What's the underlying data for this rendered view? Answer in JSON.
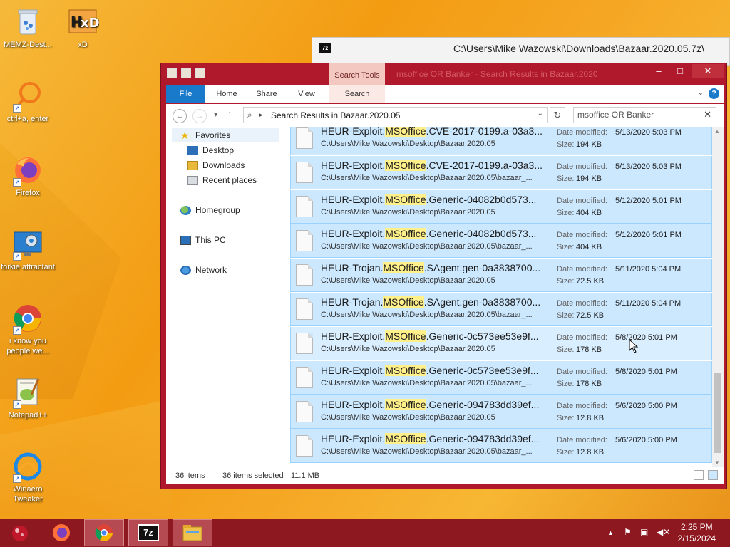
{
  "desktop": {
    "icons": [
      {
        "label": "MEMZ-Dest..."
      },
      {
        "label": "xD"
      },
      {
        "label": "ctrl+a, enter"
      },
      {
        "label": "Firefox"
      },
      {
        "label": "forkie attractant"
      },
      {
        "label": "i know you people we..."
      },
      {
        "label": "Notepad++"
      },
      {
        "label": "Winaero Tweaker"
      }
    ]
  },
  "back_window": {
    "title": "C:\\Users\\Mike Wazowski\\Downloads\\Bazaar.2020.05.7z\\",
    "icon_text": "7z"
  },
  "explorer": {
    "title": "msoffice OR Banker - Search Results in Bazaar.2020",
    "contextual_tab": "Search Tools",
    "ribbon_tabs": [
      "File",
      "Home",
      "Share",
      "View",
      "Search"
    ],
    "address": "Search Results in Bazaar.2020.05",
    "search_value": "msoffice OR Banker",
    "nav": {
      "favorites": "Favorites",
      "desktop": "Desktop",
      "downloads": "Downloads",
      "recent": "Recent places",
      "homegroup": "Homegroup",
      "thispc": "This PC",
      "network": "Network"
    },
    "labels": {
      "modified": "Date modified:",
      "size": "Size:"
    },
    "files": [
      {
        "pre": "HEUR-Exploit.",
        "hl": "MSOffice",
        "post": ".CVE-2017-0199.a-03a3...",
        "path": "C:\\Users\\Mike Wazowski\\Desktop\\Bazaar.2020.05",
        "date": "5/13/2020 5:03 PM",
        "size": "194 KB"
      },
      {
        "pre": "HEUR-Exploit.",
        "hl": "MSOffice",
        "post": ".CVE-2017-0199.a-03a3...",
        "path": "C:\\Users\\Mike Wazowski\\Desktop\\Bazaar.2020.05\\bazaar_...",
        "date": "5/13/2020 5:03 PM",
        "size": "194 KB"
      },
      {
        "pre": "HEUR-Exploit.",
        "hl": "MSOffice",
        "post": ".Generic-04082b0d573...",
        "path": "C:\\Users\\Mike Wazowski\\Desktop\\Bazaar.2020.05",
        "date": "5/12/2020 5:01 PM",
        "size": "404 KB"
      },
      {
        "pre": "HEUR-Exploit.",
        "hl": "MSOffice",
        "post": ".Generic-04082b0d573...",
        "path": "C:\\Users\\Mike Wazowski\\Desktop\\Bazaar.2020.05\\bazaar_...",
        "date": "5/12/2020 5:01 PM",
        "size": "404 KB"
      },
      {
        "pre": "HEUR-Trojan.",
        "hl": "MSOffice",
        "post": ".SAgent.gen-0a3838700...",
        "path": "C:\\Users\\Mike Wazowski\\Desktop\\Bazaar.2020.05",
        "date": "5/11/2020 5:04 PM",
        "size": "72.5 KB"
      },
      {
        "pre": "HEUR-Trojan.",
        "hl": "MSOffice",
        "post": ".SAgent.gen-0a3838700...",
        "path": "C:\\Users\\Mike Wazowski\\Desktop\\Bazaar.2020.05\\bazaar_...",
        "date": "5/11/2020 5:04 PM",
        "size": "72.5 KB"
      },
      {
        "pre": "HEUR-Exploit.",
        "hl": "MSOffice",
        "post": ".Generic-0c573ee53e9f...",
        "path": "C:\\Users\\Mike Wazowski\\Desktop\\Bazaar.2020.05",
        "date": "5/8/2020 5:01 PM",
        "size": "178 KB"
      },
      {
        "pre": "HEUR-Exploit.",
        "hl": "MSOffice",
        "post": ".Generic-0c573ee53e9f...",
        "path": "C:\\Users\\Mike Wazowski\\Desktop\\Bazaar.2020.05\\bazaar_...",
        "date": "5/8/2020 5:01 PM",
        "size": "178 KB"
      },
      {
        "pre": "HEUR-Exploit.",
        "hl": "MSOffice",
        "post": ".Generic-094783dd39ef...",
        "path": "C:\\Users\\Mike Wazowski\\Desktop\\Bazaar.2020.05",
        "date": "5/6/2020 5:00 PM",
        "size": "12.8 KB"
      },
      {
        "pre": "HEUR-Exploit.",
        "hl": "MSOffice",
        "post": ".Generic-094783dd39ef...",
        "path": "C:\\Users\\Mike Wazowski\\Desktop\\Bazaar.2020.05\\bazaar_...",
        "date": "5/6/2020 5:00 PM",
        "size": "12.8 KB"
      }
    ],
    "status": {
      "items": "36 items",
      "selected": "36 items selected",
      "size": "11.1 MB"
    }
  },
  "taskbar": {
    "time": "2:25 PM",
    "date": "2/15/2024",
    "sevenzip_label": "7z"
  },
  "colors": {
    "accent": "#b0192c",
    "selection": "#cce8ff",
    "highlight": "#fff08a",
    "taskbar": "#8d1820"
  }
}
